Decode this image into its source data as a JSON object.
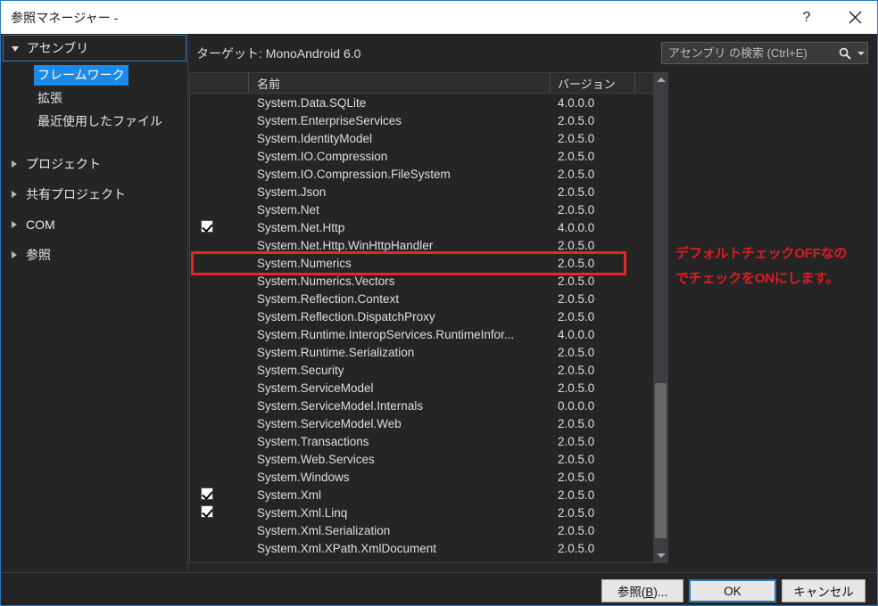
{
  "window": {
    "title": "参照マネージャー -",
    "help_label": "?",
    "close_label": "✕",
    "accent_color": "#2a7bc0"
  },
  "sidebar": {
    "root": {
      "label": "アセンブリ",
      "expanded": true
    },
    "children": [
      {
        "label": "フレームワーク",
        "selected": true
      },
      {
        "label": "拡張",
        "selected": false
      },
      {
        "label": "最近使用したファイル",
        "selected": false
      }
    ],
    "nodes": [
      {
        "label": "プロジェクト",
        "expanded": false
      },
      {
        "label": "共有プロジェクト",
        "expanded": false
      },
      {
        "label": "COM",
        "expanded": false
      },
      {
        "label": "参照",
        "expanded": false
      }
    ]
  },
  "main": {
    "target_label": "ターゲット: MonoAndroid 6.0",
    "search": {
      "placeholder": "アセンブリ の検索 (Ctrl+E)",
      "value": "",
      "icon": "search-icon",
      "dropdown_icon": "chevron-down-icon"
    },
    "columns": {
      "check": "",
      "name": "名前",
      "version": "バージョン"
    },
    "rows": [
      {
        "checked": false,
        "name": "System.Data.SQLite",
        "version": "4.0.0.0"
      },
      {
        "checked": false,
        "name": "System.EnterpriseServices",
        "version": "2.0.5.0"
      },
      {
        "checked": false,
        "name": "System.IdentityModel",
        "version": "2.0.5.0"
      },
      {
        "checked": false,
        "name": "System.IO.Compression",
        "version": "2.0.5.0"
      },
      {
        "checked": false,
        "name": "System.IO.Compression.FileSystem",
        "version": "2.0.5.0"
      },
      {
        "checked": false,
        "name": "System.Json",
        "version": "2.0.5.0"
      },
      {
        "checked": false,
        "name": "System.Net",
        "version": "2.0.5.0"
      },
      {
        "checked": true,
        "name": "System.Net.Http",
        "version": "4.0.0.0",
        "highlighted": true
      },
      {
        "checked": false,
        "name": "System.Net.Http.WinHttpHandler",
        "version": "2.0.5.0"
      },
      {
        "checked": false,
        "name": "System.Numerics",
        "version": "2.0.5.0"
      },
      {
        "checked": false,
        "name": "System.Numerics.Vectors",
        "version": "2.0.5.0"
      },
      {
        "checked": false,
        "name": "System.Reflection.Context",
        "version": "2.0.5.0"
      },
      {
        "checked": false,
        "name": "System.Reflection.DispatchProxy",
        "version": "2.0.5.0"
      },
      {
        "checked": false,
        "name": "System.Runtime.InteropServices.RuntimeInfor...",
        "version": "4.0.0.0"
      },
      {
        "checked": false,
        "name": "System.Runtime.Serialization",
        "version": "2.0.5.0"
      },
      {
        "checked": false,
        "name": "System.Security",
        "version": "2.0.5.0"
      },
      {
        "checked": false,
        "name": "System.ServiceModel",
        "version": "2.0.5.0"
      },
      {
        "checked": false,
        "name": "System.ServiceModel.Internals",
        "version": "0.0.0.0"
      },
      {
        "checked": false,
        "name": "System.ServiceModel.Web",
        "version": "2.0.5.0"
      },
      {
        "checked": false,
        "name": "System.Transactions",
        "version": "2.0.5.0"
      },
      {
        "checked": false,
        "name": "System.Web.Services",
        "version": "2.0.5.0"
      },
      {
        "checked": false,
        "name": "System.Windows",
        "version": "2.0.5.0"
      },
      {
        "checked": true,
        "name": "System.Xml",
        "version": "2.0.5.0"
      },
      {
        "checked": true,
        "name": "System.Xml.Linq",
        "version": "2.0.5.0"
      },
      {
        "checked": false,
        "name": "System.Xml.Serialization",
        "version": "2.0.5.0"
      },
      {
        "checked": false,
        "name": "System.Xml.XPath.XmlDocument",
        "version": "2.0.5.0"
      }
    ]
  },
  "annotation": {
    "line1": "デフォルトチェックOFFなの",
    "line2": "でチェックをONにします。",
    "color": "#e01b24",
    "box_color": "#e8252a"
  },
  "footer": {
    "browse_prefix": "参照(",
    "browse_key": "B",
    "browse_suffix": ")...",
    "ok_label": "OK",
    "cancel_label": "キャンセル"
  }
}
